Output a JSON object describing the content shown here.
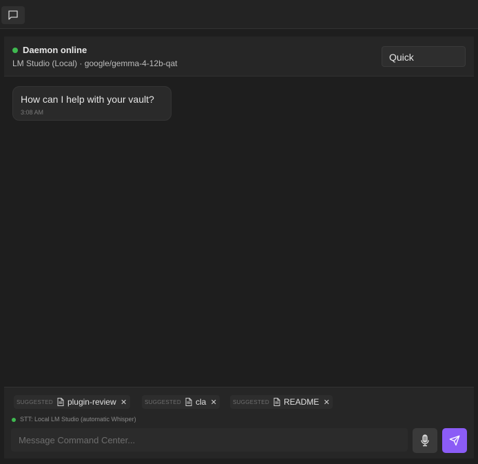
{
  "topbar": {
    "chat_icon": "message-square-icon"
  },
  "status": {
    "title": "Daemon online",
    "subtitle": "LM Studio (Local) · google/gemma-4-12b-qat",
    "dot_color": "#3fb950",
    "mode": "Quick"
  },
  "messages": [
    {
      "text": "How can I help with your vault?",
      "time": "3:08 AM"
    }
  ],
  "composer": {
    "chips": [
      {
        "tag": "SUGGESTED",
        "label": "plugin-review",
        "icon": "file-icon"
      },
      {
        "tag": "SUGGESTED",
        "label": "cla",
        "icon": "file-icon"
      },
      {
        "tag": "SUGGESTED",
        "label": "README",
        "icon": "file-icon"
      }
    ],
    "stt_status": "STT: Local LM Studio (automatic Whisper)",
    "input_placeholder": "Message Command Center...",
    "mic_icon": "microphone-icon",
    "send_icon": "send-icon",
    "accent": "#8b5cf6"
  }
}
